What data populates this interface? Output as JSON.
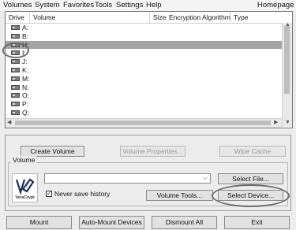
{
  "menu": [
    "Volumes",
    "System",
    "Favorites",
    "Tools",
    "Settings",
    "Help"
  ],
  "homepage_label": "Homepage",
  "volume_list": {
    "columns": [
      "Drive",
      "Volume",
      "Size",
      "Encryption Algorithm",
      "Type"
    ],
    "drives": [
      "A:",
      "B:",
      "H:",
      "I:",
      "J:",
      "K:",
      "M:",
      "N:",
      "O:",
      "P:",
      "Q:"
    ],
    "selected_drive": "H:"
  },
  "buttons": {
    "create_volume": "Create Volume",
    "volume_properties": "Volume Properties...",
    "wipe_cache": "Wipe Cache",
    "select_file": "Select File...",
    "volume_tools": "Volume Tools...",
    "select_device": "Select Device...",
    "mount": "Mount",
    "auto_mount": "Auto-Mount Devices",
    "dismount_all": "Dismount All",
    "exit": "Exit"
  },
  "volume_group": {
    "label": "Volume",
    "path_value": "",
    "never_save_history_label": "Never save history",
    "never_save_history_checked": true,
    "logo_text": "VeraCrypt"
  }
}
